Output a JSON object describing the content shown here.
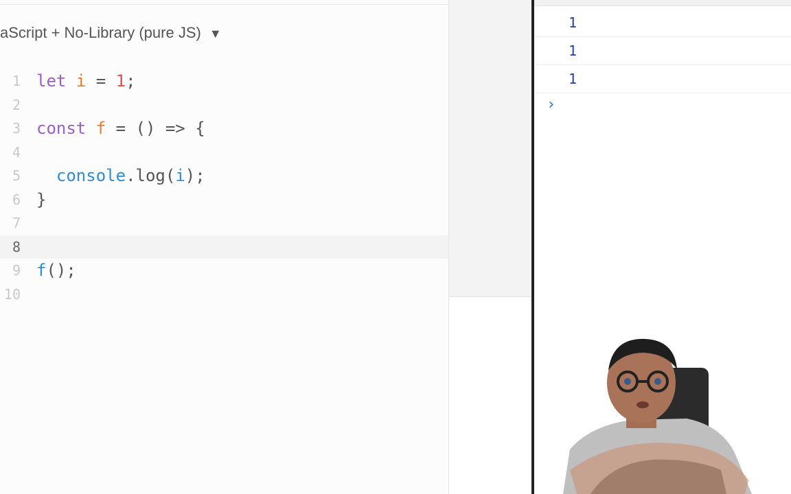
{
  "editor": {
    "language_selector": "aScript + No-Library (pure JS)",
    "active_line": 8,
    "lines": [
      {
        "num": "1",
        "tokens": [
          {
            "t": "let",
            "c": "kw"
          },
          {
            "t": " ",
            "c": "punc"
          },
          {
            "t": "i",
            "c": "var"
          },
          {
            "t": " = ",
            "c": "punc"
          },
          {
            "t": "1",
            "c": "num"
          },
          {
            "t": ";",
            "c": "punc"
          }
        ]
      },
      {
        "num": "2",
        "tokens": []
      },
      {
        "num": "3",
        "tokens": [
          {
            "t": "const",
            "c": "kw"
          },
          {
            "t": " ",
            "c": "punc"
          },
          {
            "t": "f",
            "c": "var"
          },
          {
            "t": " = () => {",
            "c": "punc"
          }
        ]
      },
      {
        "num": "4",
        "tokens": []
      },
      {
        "num": "5",
        "tokens": [
          {
            "t": "  ",
            "c": "punc"
          },
          {
            "t": "console",
            "c": "fn"
          },
          {
            "t": ".log(",
            "c": "punc"
          },
          {
            "t": "i",
            "c": "fn"
          },
          {
            "t": ");",
            "c": "punc"
          }
        ]
      },
      {
        "num": "6",
        "tokens": [
          {
            "t": "}",
            "c": "punc"
          }
        ]
      },
      {
        "num": "7",
        "tokens": []
      },
      {
        "num": "8",
        "tokens": []
      },
      {
        "num": "9",
        "tokens": [
          {
            "t": "f",
            "c": "fn"
          },
          {
            "t": "();",
            "c": "punc"
          }
        ]
      },
      {
        "num": "10",
        "tokens": []
      }
    ]
  },
  "console": {
    "outputs": [
      "1",
      "1",
      "1"
    ],
    "prompt_symbol": "›"
  },
  "webcam": {
    "icon": "presenter-webcam-icon"
  },
  "colors": {
    "keyword": "#9c5fc8",
    "variable": "#e37b2f",
    "number": "#e05151",
    "function": "#2f8dd6",
    "console_value": "#1f3fa8"
  }
}
